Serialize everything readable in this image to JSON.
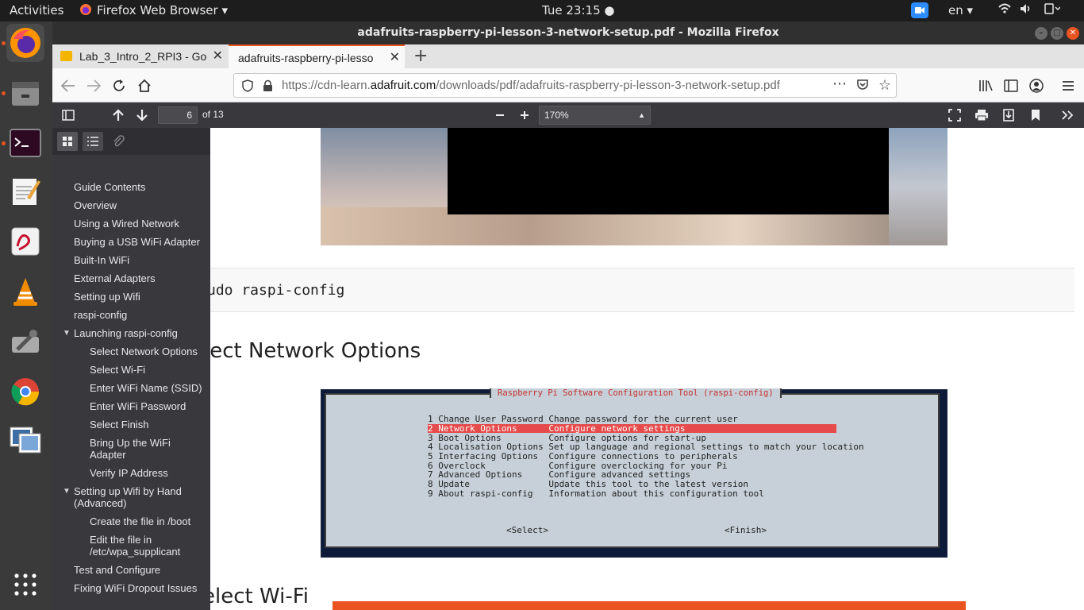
{
  "topbar": {
    "activities": "Activities",
    "app_name": "Firefox Web Browser",
    "clock": "Tue 23:15",
    "language": "en"
  },
  "window": {
    "title": "adafruits-raspberry-pi-lesson-3-network-setup.pdf - Mozilla Firefox"
  },
  "tabs": [
    {
      "label": "Lab_3_Intro_2_RPI3 - Go"
    },
    {
      "label": "adafruits-raspberry-pi-lesso"
    }
  ],
  "navbar": {
    "url_prefix": "https://cdn-learn.",
    "url_domain": "adafruit.com",
    "url_suffix": "/downloads/pdf/adafruits-raspberry-pi-lesson-3-network-setup.pdf"
  },
  "pdf_toolbar": {
    "page_number": "6",
    "page_count": "of 13",
    "zoom": "170%"
  },
  "outline": [
    {
      "label": "Guide Contents"
    },
    {
      "label": "Overview"
    },
    {
      "label": "Using a Wired Network"
    },
    {
      "label": "Buying a USB WiFi Adapter"
    },
    {
      "label": "Built-In WiFi"
    },
    {
      "label": "External Adapters"
    },
    {
      "label": "Setting up Wifi"
    },
    {
      "label": "raspi-config"
    },
    {
      "label": "Launching raspi-config"
    },
    {
      "label": "Select Network Options"
    },
    {
      "label": "Select Wi-Fi"
    },
    {
      "label": "Enter WiFi Name (SSID)"
    },
    {
      "label": "Enter WiFi Password"
    },
    {
      "label": "Select Finish"
    },
    {
      "label": "Bring Up the WiFi"
    },
    {
      "label": "Adapter"
    },
    {
      "label": "Verify IP Address"
    },
    {
      "label": "Setting up Wifi by Hand"
    },
    {
      "label": "(Advanced)"
    },
    {
      "label": "Create the file in /boot"
    },
    {
      "label": "Edit the file in"
    },
    {
      "label": "/etc/wpa_supplicant"
    },
    {
      "label": "Test and Configure"
    },
    {
      "label": "Fixing WiFi Dropout Issues"
    }
  ],
  "document": {
    "code_line": "udo raspi-config",
    "heading_1": "lect Network Options",
    "heading_2": "elect Wi-Fi",
    "terminal": {
      "title": "Raspberry Pi Software Configuration Tool (raspi-config)",
      "rows": [
        "1 Change User Password Change password for the current user",
        "2 Network Options      Configure network settings",
        "3 Boot Options         Configure options for start-up",
        "4 Localisation Options Set up language and regional settings to match your location",
        "5 Interfacing Options  Configure connections to peripherals",
        "6 Overclock            Configure overclocking for your Pi",
        "7 Advanced Options     Configure advanced settings",
        "8 Update               Update this tool to the latest version",
        "9 About raspi-config   Information about this configuration tool"
      ],
      "select_button": "<Select>",
      "finish_button": "<Finish>"
    }
  },
  "colors": {
    "accent": "#e95420",
    "terminal_highlight": "#e54b4b",
    "pdf_toolbar": "#38383d"
  }
}
